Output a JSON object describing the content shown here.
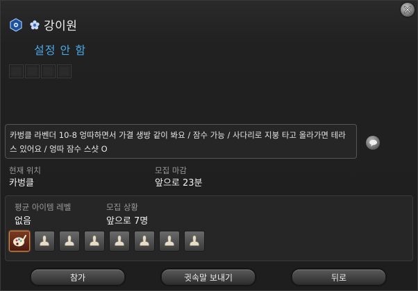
{
  "header": {
    "player_name": "강이원",
    "job_icon": "hexagon-job-icon",
    "title_icon": "flower-icon"
  },
  "status": "설정 안 함",
  "comment": "카벙클 라벤더 10-8 엉따하면서 가결 생방 같이 봐요 / 잠수 가능 / 사다리로 지붕 타고 올라가면 테라스 있어요 / 엉따 잠수 스샷 O",
  "location": {
    "label": "현재 위치",
    "value": "카벙클"
  },
  "deadline": {
    "label": "모집 마감",
    "value": "앞으로 23분"
  },
  "avg_item_level": {
    "label": "평균 아이템 레벨",
    "value": "없음"
  },
  "recruit_status": {
    "label": "모집 상황",
    "value": "앞으로 7명"
  },
  "party": {
    "filled": 1,
    "open": 7
  },
  "buttons": {
    "join": "참가",
    "whisper": "귓속말 보내기",
    "back": "뒤로"
  },
  "colors": {
    "status_blue": "#4aa8e8",
    "filled_slot": "#d48a4a"
  }
}
